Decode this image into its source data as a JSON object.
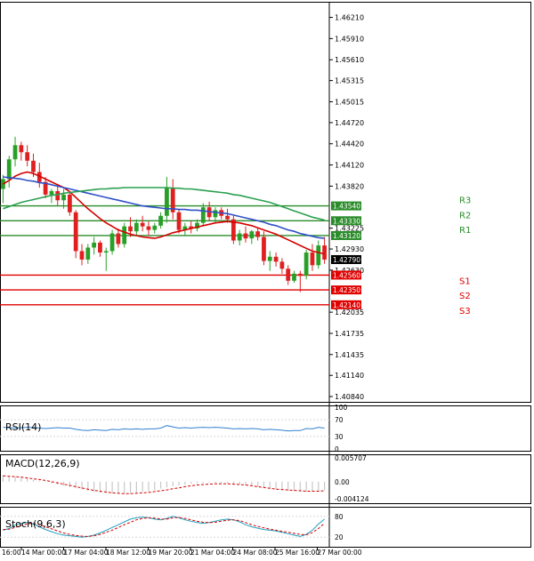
{
  "chart_data": [
    {
      "type": "candlestick",
      "panel": "price",
      "y_axis_ticks": [
        "1.46210",
        "1.45910",
        "1.45610",
        "1.45315",
        "1.45015",
        "1.44720",
        "1.44420",
        "1.44120",
        "1.43820",
        "1.43225",
        "1.42930",
        "1.42630",
        "1.42035",
        "1.41735",
        "1.41435",
        "1.41140",
        "1.40840"
      ],
      "ylim": [
        1.4079,
        1.4628
      ],
      "x_ticks": [
        "14 Mar 00:00",
        "17 Mar 04:00",
        "18 Mar 12:00",
        "19 Mar 20:00",
        "21 Mar 04:00",
        "24 Mar 08:00",
        "25 Mar 16:00",
        "27 Mar 00:00"
      ],
      "x_tick_first": "16:00",
      "candles": [
        {
          "o": 1.4378,
          "h": 1.4398,
          "l": 1.4358,
          "c": 1.4392
        },
        {
          "o": 1.4392,
          "h": 1.4425,
          "l": 1.438,
          "c": 1.442
        },
        {
          "o": 1.442,
          "h": 1.4452,
          "l": 1.441,
          "c": 1.444
        },
        {
          "o": 1.444,
          "h": 1.4445,
          "l": 1.4418,
          "c": 1.443
        },
        {
          "o": 1.443,
          "h": 1.444,
          "l": 1.441,
          "c": 1.4418
        },
        {
          "o": 1.4418,
          "h": 1.4428,
          "l": 1.4395,
          "c": 1.4402
        },
        {
          "o": 1.4402,
          "h": 1.4415,
          "l": 1.438,
          "c": 1.4388
        },
        {
          "o": 1.4388,
          "h": 1.4395,
          "l": 1.4365,
          "c": 1.437
        },
        {
          "o": 1.437,
          "h": 1.4378,
          "l": 1.4358,
          "c": 1.4375
        },
        {
          "o": 1.4375,
          "h": 1.4385,
          "l": 1.4355,
          "c": 1.4362
        },
        {
          "o": 1.4362,
          "h": 1.4378,
          "l": 1.435,
          "c": 1.437
        },
        {
          "o": 1.437,
          "h": 1.4375,
          "l": 1.434,
          "c": 1.4345
        },
        {
          "o": 1.4345,
          "h": 1.4348,
          "l": 1.428,
          "c": 1.429
        },
        {
          "o": 1.429,
          "h": 1.43,
          "l": 1.427,
          "c": 1.4278
        },
        {
          "o": 1.4278,
          "h": 1.43,
          "l": 1.4272,
          "c": 1.4295
        },
        {
          "o": 1.4295,
          "h": 1.431,
          "l": 1.4285,
          "c": 1.4302
        },
        {
          "o": 1.4302,
          "h": 1.4305,
          "l": 1.4282,
          "c": 1.4288
        },
        {
          "o": 1.4288,
          "h": 1.4295,
          "l": 1.4262,
          "c": 1.429
        },
        {
          "o": 1.429,
          "h": 1.432,
          "l": 1.4285,
          "c": 1.4315
        },
        {
          "o": 1.4315,
          "h": 1.4322,
          "l": 1.4295,
          "c": 1.43
        },
        {
          "o": 1.43,
          "h": 1.433,
          "l": 1.4295,
          "c": 1.4325
        },
        {
          "o": 1.4325,
          "h": 1.4338,
          "l": 1.431,
          "c": 1.4318
        },
        {
          "o": 1.4318,
          "h": 1.4335,
          "l": 1.4312,
          "c": 1.433
        },
        {
          "o": 1.433,
          "h": 1.434,
          "l": 1.4318,
          "c": 1.4325
        },
        {
          "o": 1.4325,
          "h": 1.4332,
          "l": 1.4312,
          "c": 1.432
        },
        {
          "o": 1.432,
          "h": 1.433,
          "l": 1.4315,
          "c": 1.4326
        },
        {
          "o": 1.4326,
          "h": 1.4345,
          "l": 1.4322,
          "c": 1.434
        },
        {
          "o": 1.434,
          "h": 1.4395,
          "l": 1.433,
          "c": 1.438
        },
        {
          "o": 1.438,
          "h": 1.4392,
          "l": 1.4335,
          "c": 1.4345
        },
        {
          "o": 1.4345,
          "h": 1.435,
          "l": 1.4315,
          "c": 1.432
        },
        {
          "o": 1.432,
          "h": 1.433,
          "l": 1.4312,
          "c": 1.4325
        },
        {
          "o": 1.4325,
          "h": 1.4332,
          "l": 1.4315,
          "c": 1.4322
        },
        {
          "o": 1.4322,
          "h": 1.4335,
          "l": 1.4318,
          "c": 1.433
        },
        {
          "o": 1.433,
          "h": 1.4358,
          "l": 1.4325,
          "c": 1.4352
        },
        {
          "o": 1.4352,
          "h": 1.436,
          "l": 1.4332,
          "c": 1.4338
        },
        {
          "o": 1.4338,
          "h": 1.4352,
          "l": 1.433,
          "c": 1.4348
        },
        {
          "o": 1.4348,
          "h": 1.4352,
          "l": 1.4335,
          "c": 1.434
        },
        {
          "o": 1.434,
          "h": 1.435,
          "l": 1.433,
          "c": 1.4335
        },
        {
          "o": 1.4335,
          "h": 1.434,
          "l": 1.43,
          "c": 1.4305
        },
        {
          "o": 1.4305,
          "h": 1.432,
          "l": 1.4298,
          "c": 1.4315
        },
        {
          "o": 1.4315,
          "h": 1.4325,
          "l": 1.4302,
          "c": 1.4308
        },
        {
          "o": 1.4308,
          "h": 1.432,
          "l": 1.43,
          "c": 1.4318
        },
        {
          "o": 1.4318,
          "h": 1.4322,
          "l": 1.4305,
          "c": 1.431
        },
        {
          "o": 1.431,
          "h": 1.4318,
          "l": 1.427,
          "c": 1.4276
        },
        {
          "o": 1.4276,
          "h": 1.429,
          "l": 1.4262,
          "c": 1.4282
        },
        {
          "o": 1.4282,
          "h": 1.4288,
          "l": 1.4268,
          "c": 1.4275
        },
        {
          "o": 1.4275,
          "h": 1.428,
          "l": 1.4258,
          "c": 1.4265
        },
        {
          "o": 1.4265,
          "h": 1.427,
          "l": 1.4242,
          "c": 1.4248
        },
        {
          "o": 1.4248,
          "h": 1.4262,
          "l": 1.4245,
          "c": 1.4258
        },
        {
          "o": 1.4258,
          "h": 1.4262,
          "l": 1.4232,
          "c": 1.4255
        },
        {
          "o": 1.4255,
          "h": 1.4292,
          "l": 1.425,
          "c": 1.4288
        },
        {
          "o": 1.4288,
          "h": 1.43,
          "l": 1.4262,
          "c": 1.427
        },
        {
          "o": 1.427,
          "h": 1.4305,
          "l": 1.4265,
          "c": 1.4298
        },
        {
          "o": 1.4298,
          "h": 1.431,
          "l": 1.4272,
          "c": 1.4278
        }
      ],
      "series": [
        {
          "name": "",
          "color": "#d40000",
          "values": [
            1.4385,
            1.439,
            1.4396,
            1.44,
            1.4402,
            1.44,
            1.4396,
            1.4392,
            1.4388,
            1.4384,
            1.438,
            1.4374,
            1.4366,
            1.4358,
            1.435,
            1.4343,
            1.4336,
            1.433,
            1.4325,
            1.432,
            1.4317,
            1.4314,
            1.4312,
            1.431,
            1.4309,
            1.4308,
            1.431,
            1.4313,
            1.4316,
            1.4318,
            1.432,
            1.4322,
            1.4324,
            1.4326,
            1.4328,
            1.433,
            1.4331,
            1.4332,
            1.4331,
            1.433,
            1.4328,
            1.4326,
            1.4323,
            1.432,
            1.4317,
            1.4314,
            1.431,
            1.4306,
            1.4302,
            1.4298,
            1.4294,
            1.429,
            1.4288,
            1.4286
          ]
        },
        {
          "name": "",
          "color": "#3050c8",
          "values": [
            1.4395,
            1.4394,
            1.4393,
            1.4392,
            1.439,
            1.4389,
            1.4387,
            1.4386,
            1.4384,
            1.4382,
            1.438,
            1.4378,
            1.4376,
            1.4374,
            1.4372,
            1.437,
            1.4368,
            1.4366,
            1.4364,
            1.4362,
            1.436,
            1.4358,
            1.4356,
            1.4354,
            1.4353,
            1.4352,
            1.4351,
            1.435,
            1.435,
            1.4349,
            1.4349,
            1.4348,
            1.4348,
            1.4347,
            1.4346,
            1.4345,
            1.4344,
            1.4343,
            1.4341,
            1.4339,
            1.4337,
            1.4335,
            1.4333,
            1.4331,
            1.4328,
            1.4326,
            1.4323,
            1.432,
            1.4318,
            1.4315,
            1.4313,
            1.4311,
            1.4309,
            1.4308
          ]
        },
        {
          "name": "",
          "color": "#2aa050",
          "values": [
            1.435,
            1.4353,
            1.4356,
            1.4359,
            1.4361,
            1.4363,
            1.4365,
            1.4367,
            1.4369,
            1.437,
            1.4372,
            1.4373,
            1.4374,
            1.4375,
            1.4376,
            1.4377,
            1.4378,
            1.4378,
            1.4379,
            1.4379,
            1.438,
            1.438,
            1.438,
            1.438,
            1.438,
            1.438,
            1.438,
            1.438,
            1.4379,
            1.4379,
            1.4378,
            1.4378,
            1.4377,
            1.4376,
            1.4375,
            1.4374,
            1.4373,
            1.4372,
            1.437,
            1.4369,
            1.4367,
            1.4365,
            1.4363,
            1.4361,
            1.4359,
            1.4356,
            1.4353,
            1.435,
            1.4347,
            1.4344,
            1.4341,
            1.4338,
            1.4336,
            1.4334
          ]
        }
      ],
      "current_price": "1.42790",
      "levels": [
        {
          "name": "R3",
          "value": 1.4354,
          "label": "1.43540",
          "color": "#2a8c2a"
        },
        {
          "name": "R2",
          "value": 1.4333,
          "label": "1.43330",
          "color": "#2a8c2a"
        },
        {
          "name": "R1",
          "value": 1.4312,
          "label": "1.43120",
          "color": "#2a8c2a"
        },
        {
          "name": "S1",
          "value": 1.4256,
          "label": "1.42560",
          "color": "#e00000"
        },
        {
          "name": "S2",
          "value": 1.4235,
          "label": "1.42350",
          "color": "#e00000"
        },
        {
          "name": "S3",
          "value": 1.4214,
          "label": "1.42140",
          "color": "#e00000"
        }
      ]
    },
    {
      "type": "line",
      "panel": "rsi",
      "title": "RSI(14)",
      "y_axis_ticks": [
        "100",
        "70",
        "30",
        "0"
      ],
      "ylim": [
        0,
        100
      ],
      "color": "#3080d0",
      "values": [
        52,
        51,
        50,
        51,
        52,
        51,
        50,
        49,
        50,
        51,
        50,
        50,
        47,
        45,
        44,
        46,
        45,
        44,
        47,
        46,
        48,
        47,
        48,
        47,
        48,
        48,
        50,
        56,
        53,
        50,
        51,
        50,
        51,
        52,
        51,
        52,
        51,
        50,
        48,
        49,
        48,
        49,
        48,
        46,
        47,
        46,
        45,
        43,
        44,
        44,
        49,
        48,
        52,
        50
      ]
    },
    {
      "type": "bar",
      "panel": "macd",
      "title": "MACD(12,26,9)",
      "y_axis_ticks": [
        "0.005707",
        "0.00",
        "-0.004124"
      ],
      "ylim": [
        -0.0052,
        0.0066
      ],
      "color": "#c8c8c8",
      "signal_color": "#d40000",
      "values": [
        0.0016,
        0.0014,
        0.0012,
        0.001,
        0.0008,
        0.0005,
        0.0002,
        -0.0001,
        -0.0004,
        -0.0007,
        -0.001,
        -0.0013,
        -0.0016,
        -0.0019,
        -0.0022,
        -0.0025,
        -0.0027,
        -0.0028,
        -0.0029,
        -0.003,
        -0.0029,
        -0.0028,
        -0.0027,
        -0.0025,
        -0.0023,
        -0.002,
        -0.0017,
        -0.0014,
        -0.0011,
        -0.0009,
        -0.0007,
        -0.0005,
        -0.0004,
        -0.0003,
        -0.0002,
        -0.0002,
        -0.0003,
        -0.0004,
        -0.0005,
        -0.0007,
        -0.0009,
        -0.0011,
        -0.0013,
        -0.0015,
        -0.0017,
        -0.0019,
        -0.0021,
        -0.0022,
        -0.0023,
        -0.0024,
        -0.0024,
        -0.0023,
        -0.0022,
        -0.0021
      ],
      "signal": [
        0.0014,
        0.0013,
        0.0012,
        0.0011,
        0.0009,
        0.0007,
        0.0005,
        0.0003,
        0.0,
        -0.0003,
        -0.0006,
        -0.0009,
        -0.0012,
        -0.0015,
        -0.0018,
        -0.0021,
        -0.0023,
        -0.0025,
        -0.0027,
        -0.0028,
        -0.0029,
        -0.0029,
        -0.0028,
        -0.0027,
        -0.0026,
        -0.0024,
        -0.0022,
        -0.002,
        -0.0017,
        -0.0015,
        -0.0012,
        -0.001,
        -0.0008,
        -0.0007,
        -0.0006,
        -0.0005,
        -0.0005,
        -0.0005,
        -0.0006,
        -0.0007,
        -0.0008,
        -0.001,
        -0.0012,
        -0.0014,
        -0.0016,
        -0.0018,
        -0.0019,
        -0.002,
        -0.0021,
        -0.0022,
        -0.0023,
        -0.0023,
        -0.0023,
        -0.0022
      ]
    },
    {
      "type": "line",
      "panel": "stoch",
      "title": "Stoch(9,6,3)",
      "y_axis_ticks": [
        "80",
        "20"
      ],
      "ylim": [
        0,
        100
      ],
      "k_color": "#20a0c0",
      "d_color": "#d40000",
      "k": [
        40,
        45,
        55,
        60,
        62,
        58,
        50,
        42,
        36,
        30,
        26,
        24,
        22,
        20,
        22,
        26,
        32,
        40,
        48,
        56,
        64,
        72,
        76,
        78,
        76,
        72,
        70,
        74,
        80,
        76,
        70,
        66,
        62,
        60,
        62,
        66,
        70,
        72,
        70,
        64,
        56,
        50,
        46,
        42,
        40,
        38,
        34,
        30,
        26,
        22,
        28,
        40,
        58,
        72
      ],
      "d": [
        42,
        43,
        48,
        54,
        58,
        60,
        56,
        50,
        44,
        38,
        32,
        28,
        25,
        23,
        22,
        24,
        28,
        34,
        40,
        48,
        56,
        63,
        70,
        74,
        76,
        75,
        72,
        72,
        76,
        77,
        74,
        70,
        66,
        63,
        62,
        63,
        66,
        69,
        70,
        68,
        62,
        56,
        51,
        47,
        43,
        40,
        37,
        34,
        31,
        28,
        27,
        33,
        45,
        60
      ]
    }
  ]
}
